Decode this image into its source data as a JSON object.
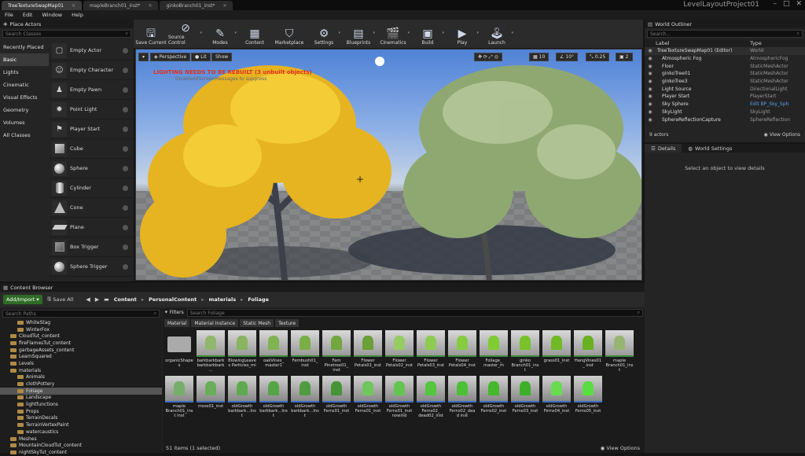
{
  "tabs": [
    {
      "label": "TreeTextureSwapMap01",
      "active": true
    },
    {
      "label": "mapleBranch01_inst*",
      "active": false
    },
    {
      "label": "ginkoBranch01_inst*",
      "active": false
    }
  ],
  "project": "LevelLayoutProject01",
  "menu": [
    "File",
    "Edit",
    "Window",
    "Help"
  ],
  "place_actors": {
    "title": "Place Actors",
    "search_placeholder": "Search Classes",
    "categories": [
      "Recently Placed",
      "Basic",
      "Lights",
      "Cinematic",
      "Visual Effects",
      "Geometry",
      "Volumes",
      "All Classes"
    ],
    "selected_category": "Basic",
    "actors": [
      "Empty Actor",
      "Empty Character",
      "Empty Pawn",
      "Point Light",
      "Player Start",
      "Cube",
      "Sphere",
      "Cylinder",
      "Cone",
      "Plane",
      "Box Trigger",
      "Sphere Trigger"
    ]
  },
  "toolbar": [
    {
      "label": "Save Current",
      "icon": "save-icon",
      "glyph": "🖫"
    },
    {
      "label": "Source Control",
      "icon": "source-control-icon",
      "glyph": "⊘"
    },
    {
      "label": "Modes",
      "icon": "modes-icon",
      "glyph": "✎"
    },
    {
      "label": "Content",
      "icon": "content-icon",
      "glyph": "▦"
    },
    {
      "label": "Marketplace",
      "icon": "marketplace-icon",
      "glyph": "⛉"
    },
    {
      "label": "Settings",
      "icon": "settings-icon",
      "glyph": "⚙"
    },
    {
      "label": "Blueprints",
      "icon": "blueprints-icon",
      "glyph": "▤"
    },
    {
      "label": "Cinematics",
      "icon": "cinematics-icon",
      "glyph": "🎬"
    },
    {
      "label": "Build",
      "icon": "build-icon",
      "glyph": "▣"
    },
    {
      "label": "Play",
      "icon": "play-icon",
      "glyph": "▶"
    },
    {
      "label": "Launch",
      "icon": "launch-icon",
      "glyph": "🕹"
    }
  ],
  "viewport": {
    "perspective": "Perspective",
    "lit": "Lit",
    "show": "Show",
    "warning": "LIGHTING NEEDS TO BE REBUILT (3 unbuilt objects)",
    "warning_sub": "DisableAllScreenMessages to suppress",
    "grid": "10",
    "angle": "10°",
    "scale": "0.25",
    "camera_speed": "2"
  },
  "outliner": {
    "title": "World Outliner",
    "search_placeholder": "Search...",
    "col_label": "Label",
    "col_type": "Type",
    "rows": [
      {
        "label": "TreeTextureSwapMap01 (Editor)",
        "type": "World"
      },
      {
        "label": "Atmospheric Fog",
        "type": "AtmosphericFog"
      },
      {
        "label": "Floor",
        "type": "StaticMeshActor"
      },
      {
        "label": "ginkoTree01",
        "type": "StaticMeshActor"
      },
      {
        "label": "ginkoTree3",
        "type": "StaticMeshActor"
      },
      {
        "label": "Light Source",
        "type": "DirectionalLight"
      },
      {
        "label": "Player Start",
        "type": "PlayerStart"
      },
      {
        "label": "Sky Sphere",
        "type": "Edit BP_Sky_Sph"
      },
      {
        "label": "SkyLight",
        "type": "SkyLight"
      },
      {
        "label": "SphereReflectionCapture",
        "type": "SphereReflection"
      }
    ],
    "count": "9 actors",
    "view_options": "View Options"
  },
  "details": {
    "tab_details": "Details",
    "tab_world": "World Settings",
    "empty": "Select an object to view details"
  },
  "content_browser": {
    "title": "Content Browser",
    "add_import": "Add/Import",
    "save_all": "Save All",
    "breadcrumb": [
      "Content",
      "PersonalContent",
      "materials",
      "Foliage"
    ],
    "search_paths": "Search Paths",
    "filters": "Filters",
    "search_placeholder": "Search Foliage",
    "filter_tabs": [
      "Material",
      "Material Instance",
      "Static Mesh",
      "Texture"
    ],
    "tree": [
      {
        "label": "WhiteStag",
        "indent": 2
      },
      {
        "label": "WinterFox",
        "indent": 2
      },
      {
        "label": "CloudTut_content",
        "indent": 1
      },
      {
        "label": "fireFlamesTut_content",
        "indent": 1
      },
      {
        "label": "garbageAssets_content",
        "indent": 1
      },
      {
        "label": "LearnSquared",
        "indent": 1
      },
      {
        "label": "Levels",
        "indent": 1
      },
      {
        "label": "materials",
        "indent": 1
      },
      {
        "label": "Animals",
        "indent": 2
      },
      {
        "label": "clothPottery",
        "indent": 2
      },
      {
        "label": "Foliage",
        "indent": 2,
        "selected": true
      },
      {
        "label": "Landscape",
        "indent": 2
      },
      {
        "label": "lightfunctions",
        "indent": 2
      },
      {
        "label": "Props",
        "indent": 2
      },
      {
        "label": "TerrainDecals",
        "indent": 2
      },
      {
        "label": "TerrainVertexPaint",
        "indent": 2
      },
      {
        "label": "watercaustics",
        "indent": 2
      },
      {
        "label": "Meshes",
        "indent": 1
      },
      {
        "label": "MountainCloudTut_content",
        "indent": 1
      },
      {
        "label": "nightSkyTut_content",
        "indent": 1
      }
    ],
    "assets_row1": [
      {
        "name": "organicShapes",
        "kind": "folder"
      },
      {
        "name": "barkbarkbarkbarkbarkbark...",
        "kind": "mat"
      },
      {
        "name": "BlowingLeaves Particles_mi",
        "kind": "mat"
      },
      {
        "name": "oakVines_ master1",
        "kind": "mat"
      },
      {
        "name": "Fernbush01_ inst",
        "kind": "mat"
      },
      {
        "name": "Fern Pinetree01_ inst",
        "kind": "mat"
      },
      {
        "name": "Flower Petals01_inst",
        "kind": "mat"
      },
      {
        "name": "Flower Petals02_inst",
        "kind": "mat"
      },
      {
        "name": "Flower Petals03_inst",
        "kind": "mat"
      },
      {
        "name": "Flower Petals04_inst",
        "kind": "mat"
      },
      {
        "name": "Foliage_ master_m",
        "kind": "mat"
      },
      {
        "name": "ginko Branch01_inst",
        "kind": "mat"
      },
      {
        "name": "grass01_inst",
        "kind": "mat"
      },
      {
        "name": "HangVines01_ inst",
        "kind": "mat"
      },
      {
        "name": "maple Branch01_inst",
        "kind": "mat"
      }
    ],
    "assets_row2": [
      {
        "name": "maple Branch01_inst inst",
        "kind": "sm"
      },
      {
        "name": "moss01_inst",
        "kind": "sm"
      },
      {
        "name": "oldGrowth barkbark...Inst",
        "kind": "sm"
      },
      {
        "name": "oldGrowth barkbark...Inst",
        "kind": "sm"
      },
      {
        "name": "oldGrowth barkbark...Inst",
        "kind": "sm"
      },
      {
        "name": "oldGrowth Ferns01_inst",
        "kind": "sm"
      },
      {
        "name": "oldGrowth Ferns01_inst",
        "kind": "sm"
      },
      {
        "name": "oldGrowth Ferns01_inst nowind",
        "kind": "sm"
      },
      {
        "name": "oldGrowth Ferns02_ dead02_inst",
        "kind": "sm"
      },
      {
        "name": "oldGrowth Ferns02_dead inst",
        "kind": "sm"
      },
      {
        "name": "oldGrowth Ferns02_inst",
        "kind": "sm"
      },
      {
        "name": "oldGrowth Ferns03_inst",
        "kind": "sm"
      },
      {
        "name": "oldGrowth Ferns04_inst",
        "kind": "sm"
      },
      {
        "name": "oldGrowth Ferns05_inst",
        "kind": "sm"
      }
    ],
    "status": "51 items (1 selected)",
    "view_options": "View Options"
  }
}
